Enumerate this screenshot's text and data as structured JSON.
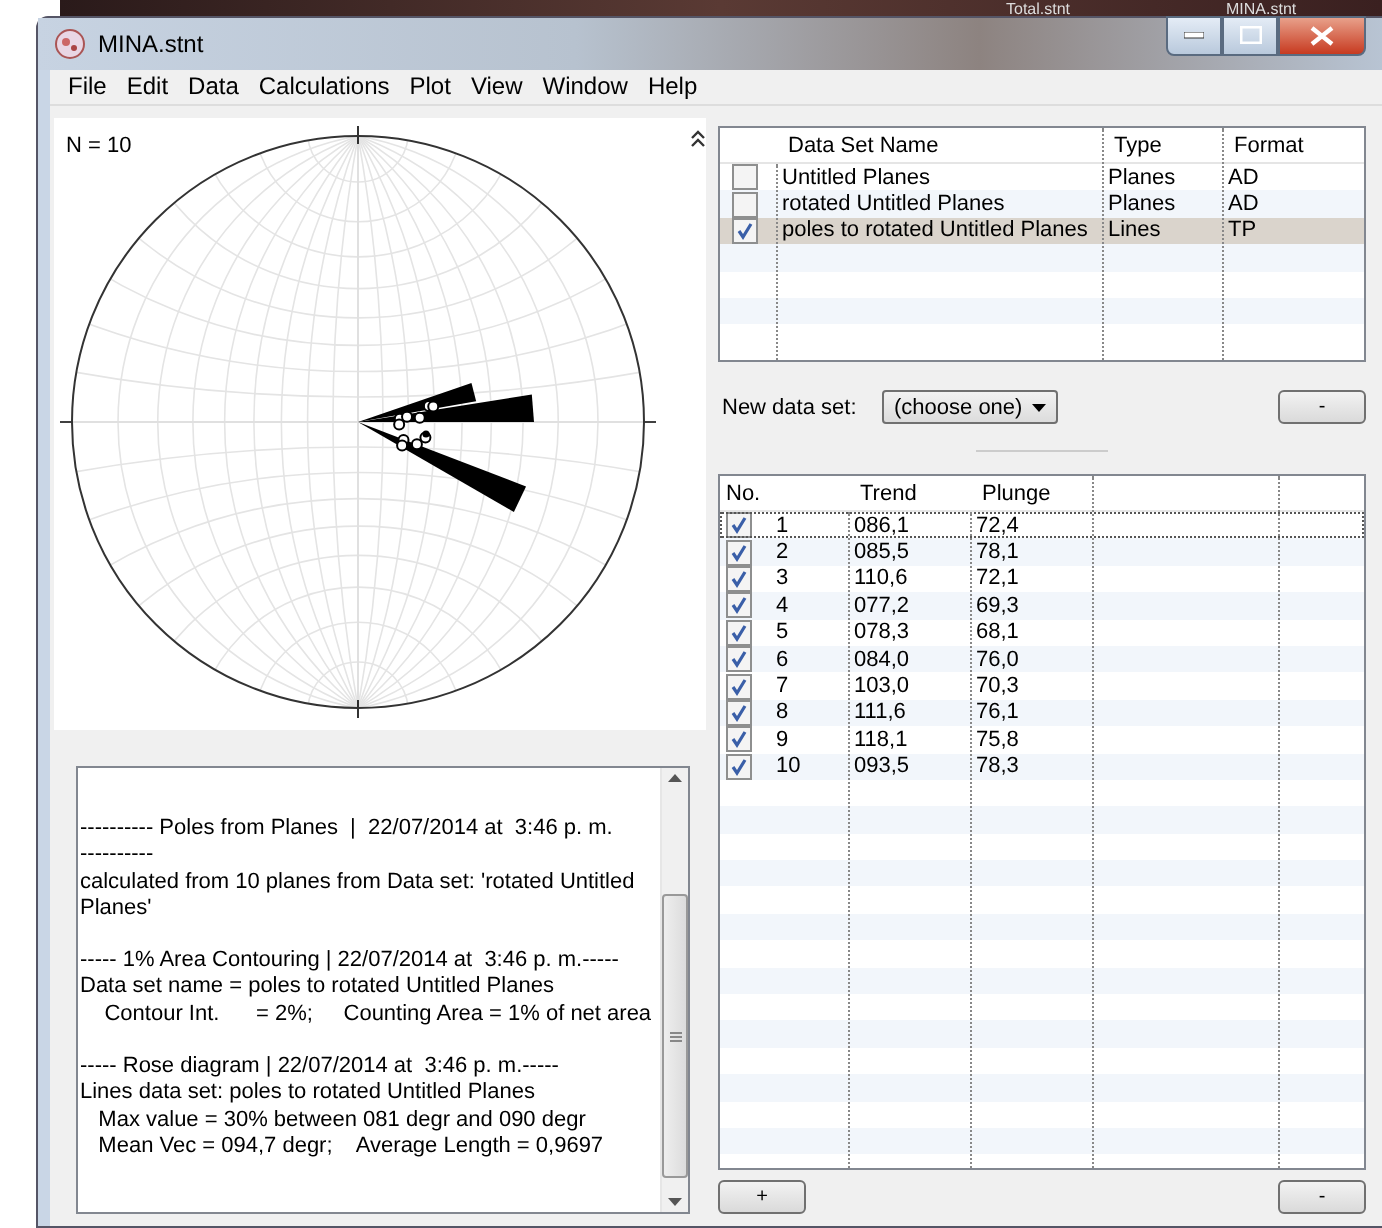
{
  "background_windows": [
    "Total.stnt",
    "MINA.stnt"
  ],
  "window": {
    "title": "MINA.stnt"
  },
  "menu": [
    "File",
    "Edit",
    "Data",
    "Calculations",
    "Plot",
    "View",
    "Window",
    "Help"
  ],
  "plot": {
    "label": "N = 10"
  },
  "log": [
    [
      "---------- Poles from Planes  |  22/07/2014 at  3:46 p. m.",
      "----------",
      "calculated from 10 planes from Data set: 'rotated Untitled",
      "Planes'"
    ],
    [
      "----- 1% Area Contouring | 22/07/2014 at  3:46 p. m.-----",
      "Data set name = poles to rotated Untitled Planes",
      "    Contour Int.      = 2%;     Counting Area = 1% of net area"
    ],
    [
      "----- Rose diagram | 22/07/2014 at  3:46 p. m.-----",
      "Lines data set: poles to rotated Untitled Planes",
      "   Max value = 30% between 081 degr and 090 degr",
      "   Mean Vec = 094,7 degr;    Average Length = 0,9697"
    ]
  ],
  "datasets": {
    "columns": [
      "Data Set Name",
      "Type",
      "Format"
    ],
    "rows": [
      {
        "name": "Untitled Planes",
        "type": "Planes",
        "format": "AD",
        "checked": false,
        "selected": false
      },
      {
        "name": "rotated Untitled Planes",
        "type": "Planes",
        "format": "AD",
        "checked": false,
        "selected": false
      },
      {
        "name": "poles to rotated Untitled Planes",
        "type": "Lines",
        "format": "TP",
        "checked": true,
        "selected": true
      }
    ]
  },
  "new_data_set": {
    "label": "New data set:",
    "value": "(choose one)",
    "button": "-"
  },
  "data": {
    "columns": [
      "No.",
      "Trend",
      "Plunge"
    ],
    "rows": [
      {
        "no": "1",
        "trend": "086,1",
        "plunge": "72,4",
        "checked": true
      },
      {
        "no": "2",
        "trend": "085,5",
        "plunge": "78,1",
        "checked": true
      },
      {
        "no": "3",
        "trend": "110,6",
        "plunge": "72,1",
        "checked": true
      },
      {
        "no": "4",
        "trend": "077,2",
        "plunge": "69,3",
        "checked": true
      },
      {
        "no": "5",
        "trend": "078,3",
        "plunge": "68,1",
        "checked": true
      },
      {
        "no": "6",
        "trend": "084,0",
        "plunge": "76,0",
        "checked": true
      },
      {
        "no": "7",
        "trend": "103,0",
        "plunge": "70,3",
        "checked": true
      },
      {
        "no": "8",
        "trend": "111,6",
        "plunge": "76,1",
        "checked": true
      },
      {
        "no": "9",
        "trend": "118,1",
        "plunge": "75,8",
        "checked": true
      },
      {
        "no": "10",
        "trend": "093,5",
        "plunge": "78,3",
        "checked": true
      }
    ]
  },
  "buttons": [
    "+",
    "-"
  ]
}
